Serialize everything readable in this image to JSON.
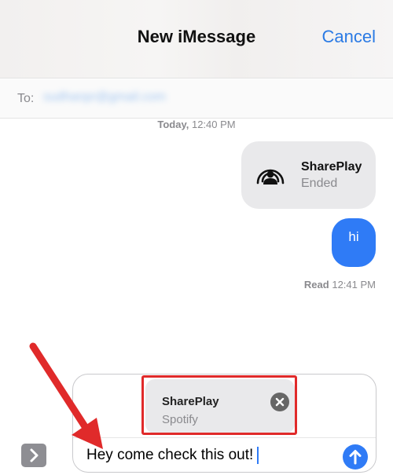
{
  "header": {
    "title": "New iMessage",
    "cancel_label": "Cancel"
  },
  "to_field": {
    "label": "To:",
    "recipient": "sudhanpr@gmail.com"
  },
  "conversation": {
    "timestamp_day": "Today,",
    "timestamp_time": "12:40 PM",
    "shareplay_message": {
      "title": "SharePlay",
      "status": "Ended",
      "icon": "shareplay-icon"
    },
    "sent_message": {
      "text": "hi"
    },
    "read_receipt": {
      "label": "Read",
      "time": "12:41 PM"
    }
  },
  "composer": {
    "attachment": {
      "title": "SharePlay",
      "subtitle": "Spotify",
      "close_icon": "close-icon"
    },
    "input_value": "Hey come check this out!",
    "send_icon": "arrow-up-icon",
    "expand_icon": "chevron-right-icon"
  },
  "colors": {
    "accent": "#2f7bf6",
    "link": "#2a7ae4",
    "annotation": "#e02a2a",
    "bubble_gray": "#e9e9eb"
  }
}
